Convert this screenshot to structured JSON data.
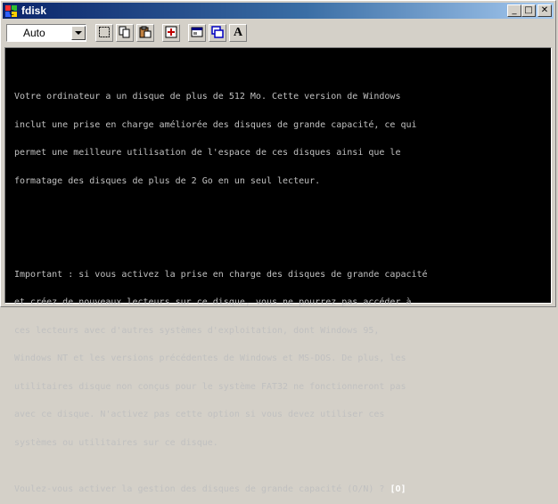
{
  "window": {
    "title": "fdisk"
  },
  "controls": {
    "minimize": "_",
    "maximize": "□",
    "close": "✕"
  },
  "toolbar": {
    "font_size": "Auto",
    "buttons": [
      "mark-icon",
      "copy-icon",
      "paste-icon",
      "fullscreen-icon",
      "properties-icon",
      "background-icon",
      "font-icon"
    ],
    "font_letter": "A"
  },
  "console": {
    "paragraph1": [
      "Votre ordinateur a un disque de plus de 512 Mo. Cette version de Windows",
      "inclut une prise en charge améliorée des disques de grande capacité, ce qui",
      "permet une meilleure utilisation de l'espace de ces disques ainsi que le",
      "formatage des disques de plus de 2 Go en un seul lecteur."
    ],
    "paragraph2": [
      "Important : si vous activez la prise en charge des disques de grande capacité",
      "et créez de nouveaux lecteurs sur ce disque, vous ne pourrez pas accéder à",
      "ces lecteurs avec d'autres systèmes d'exploitation, dont Windows 95,",
      "Windows NT et les versions précédentes de Windows et MS-DOS. De plus, les",
      "utilitaires disque non conçus pour le système FAT32 ne fonctionneront pas",
      "avec ce disque. N'activez pas cette option si vous devez utiliser ces",
      "systèmes ou utilitaires sur ce disque."
    ],
    "prompt": "Voulez-vous activer la gestion des disques de grande capacité (O/N) ? ",
    "answer": "[O]"
  },
  "colors": {
    "console_bg": "#000000",
    "console_fg": "#c0c0c0",
    "title_gradient_start": "#0a246a"
  }
}
